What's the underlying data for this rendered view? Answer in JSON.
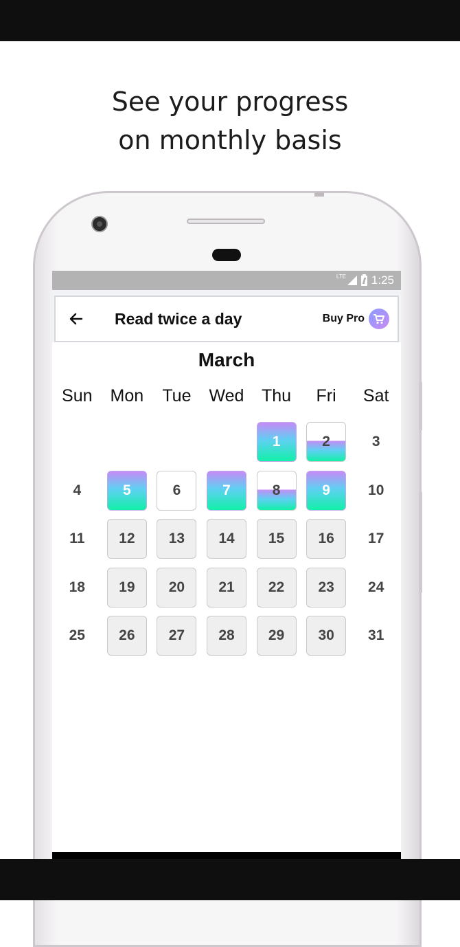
{
  "headline": {
    "line1": "See your progress",
    "line2": "on monthly basis"
  },
  "status_bar": {
    "network": "LTE",
    "time": "1:25"
  },
  "app_bar": {
    "title": "Read twice a day",
    "buy_pro_label": "Buy Pro"
  },
  "calendar": {
    "month": "March",
    "weekdays": [
      "Sun",
      "Mon",
      "Tue",
      "Wed",
      "Thu",
      "Fri",
      "Sat"
    ],
    "weeks": [
      [
        null,
        null,
        null,
        null,
        {
          "day": "1",
          "state": "done"
        },
        {
          "day": "2",
          "state": "half"
        },
        {
          "day": "3",
          "state": "plain"
        }
      ],
      [
        {
          "day": "4",
          "state": "plain"
        },
        {
          "day": "5",
          "state": "done"
        },
        {
          "day": "6",
          "state": "missed"
        },
        {
          "day": "7",
          "state": "done"
        },
        {
          "day": "8",
          "state": "half"
        },
        {
          "day": "9",
          "state": "done"
        },
        {
          "day": "10",
          "state": "plain"
        }
      ],
      [
        {
          "day": "11",
          "state": "plain"
        },
        {
          "day": "12",
          "state": "future"
        },
        {
          "day": "13",
          "state": "future"
        },
        {
          "day": "14",
          "state": "future"
        },
        {
          "day": "15",
          "state": "future"
        },
        {
          "day": "16",
          "state": "future"
        },
        {
          "day": "17",
          "state": "plain"
        }
      ],
      [
        {
          "day": "18",
          "state": "plain"
        },
        {
          "day": "19",
          "state": "future"
        },
        {
          "day": "20",
          "state": "future"
        },
        {
          "day": "21",
          "state": "future"
        },
        {
          "day": "22",
          "state": "future"
        },
        {
          "day": "23",
          "state": "future"
        },
        {
          "day": "24",
          "state": "plain"
        }
      ],
      [
        {
          "day": "25",
          "state": "plain"
        },
        {
          "day": "26",
          "state": "future"
        },
        {
          "day": "27",
          "state": "future"
        },
        {
          "day": "28",
          "state": "future"
        },
        {
          "day": "29",
          "state": "future"
        },
        {
          "day": "30",
          "state": "future"
        },
        {
          "day": "31",
          "state": "plain"
        }
      ]
    ]
  },
  "icons": {
    "back": "back-arrow-icon",
    "cart": "shopping-cart-icon",
    "camera": "camera-icon",
    "signal": "signal-icon",
    "battery": "battery-charging-icon"
  },
  "colors": {
    "gradient_top": "#c58bf6",
    "gradient_mid": "#5fd0f2",
    "gradient_bottom": "#12f0a8",
    "status_bar": "#b3b3b3"
  }
}
